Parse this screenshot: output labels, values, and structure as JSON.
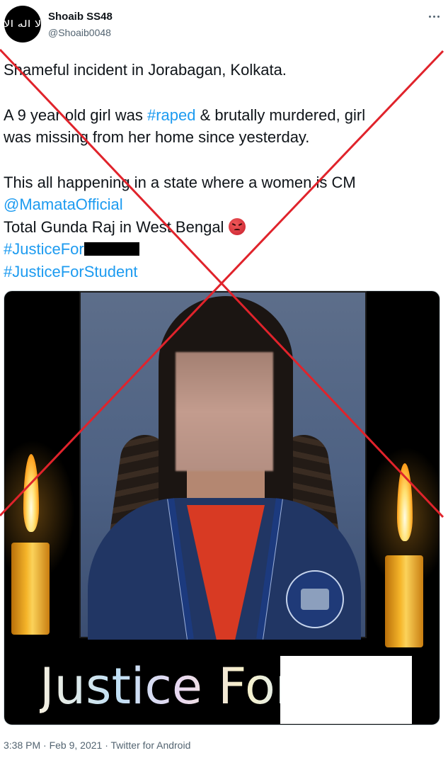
{
  "author": {
    "name": "Shoaib SS48",
    "handle": "@Shoaib0048"
  },
  "tweet": {
    "line1": "Shameful incident in Jorabagan, Kolkata.",
    "line2_a": "A 9 year old girl was ",
    "line2_hashtag": "#raped",
    "line2_b": " & brutally murdered, girl",
    "line3": "was missing from her home since yesterday.",
    "line4": "This all happening in a state where a women is CM",
    "mention": "@MamataOfficial",
    "line5": "Total Gunda Raj in West Bengal ",
    "hashtag1": "#JusticeFor",
    "hashtag2": "#JusticeForStudent"
  },
  "media": {
    "caption": "Justice For"
  },
  "footer": {
    "time": "3:38 PM",
    "date": "Feb 9, 2021",
    "separator": "·",
    "source": "Twitter for Android"
  },
  "colors": {
    "link": "#1d9bf0",
    "cross": "#e0232b",
    "muted": "#536471"
  },
  "icons": {
    "more": "more-dots-icon",
    "emoji": "angry-face-icon",
    "avatar": "calligraphy-flag-avatar"
  }
}
